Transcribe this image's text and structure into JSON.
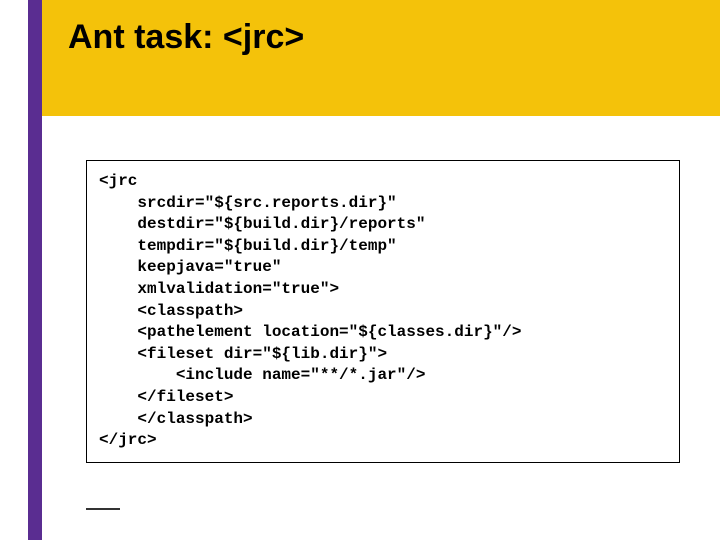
{
  "title": "Ant task:  <jrc>",
  "code": "<jrc\n    srcdir=\"${src.reports.dir}\"\n    destdir=\"${build.dir}/reports\"\n    tempdir=\"${build.dir}/temp\"\n    keepjava=\"true\"\n    xmlvalidation=\"true\">\n    <classpath>\n    <pathelement location=\"${classes.dir}\"/>\n    <fileset dir=\"${lib.dir}\">\n        <include name=\"**/*.jar\"/>\n    </fileset>\n    </classpath>\n</jrc>"
}
